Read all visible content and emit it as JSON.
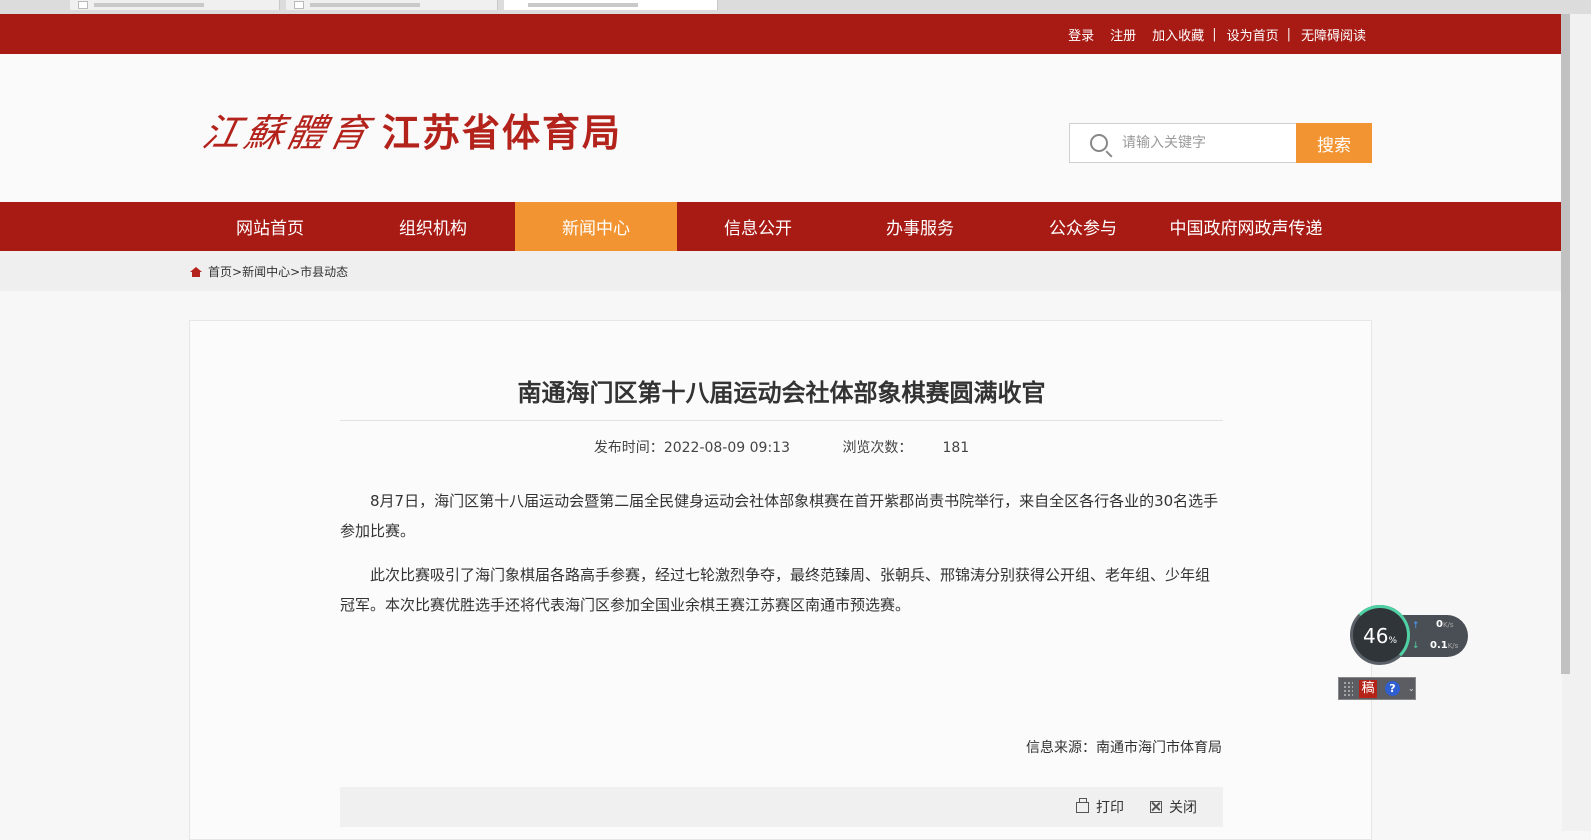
{
  "browser": {
    "tabs": [
      {
        "state": "inactive"
      },
      {
        "state": "inactive"
      },
      {
        "state": "active"
      }
    ]
  },
  "top_links": {
    "login": "登录",
    "register": "注册",
    "bookmark": "加入收藏",
    "set_home": "设为首页",
    "accessible": "无障碍阅读",
    "separator": "|"
  },
  "header": {
    "logo_calligraphy": "江蘇體育",
    "logo_text": "江苏省体育局",
    "search_placeholder": "请输入关键字",
    "search_button": "搜索"
  },
  "nav": {
    "items": [
      {
        "label": "网站首页",
        "active": false
      },
      {
        "label": "组织机构",
        "active": false
      },
      {
        "label": "新闻中心",
        "active": true
      },
      {
        "label": "信息公开",
        "active": false
      },
      {
        "label": "办事服务",
        "active": false
      },
      {
        "label": "公众参与",
        "active": false
      },
      {
        "label": "中国政府网政声传递",
        "active": false
      }
    ]
  },
  "breadcrumb": {
    "home": "首页",
    "sep": ">",
    "level1": "新闻中心",
    "level2": "市县动态"
  },
  "article": {
    "title": "南通海门区第十八届运动会社体部象棋赛圆满收官",
    "publish_label": "发布时间：",
    "publish_time": "2022-08-09 09:13",
    "views_label": "浏览次数：",
    "views": "181",
    "paragraphs": [
      "8月7日，海门区第十八届运动会暨第二届全民健身运动会社体部象棋赛在首开紫郡尚责书院举行，来自全区各行各业的30名选手参加比赛。",
      "此次比赛吸引了海门象棋届各路高手参赛，经过七轮激烈争夺，最终范臻周、张朝兵、邢锦涛分别获得公开组、老年组、少年组冠军。本次比赛优胜选手还将代表海门区参加全国业余棋王赛江苏赛区南通市预选赛。"
    ],
    "source_label": "信息来源：",
    "source": "南通市海门市体育局",
    "print": "打印",
    "close": "关闭"
  },
  "net_widget": {
    "percent": "46",
    "percent_unit": "%",
    "upload": "0",
    "download": "0.1",
    "unit": "K/s",
    "up_arrow": "↑",
    "down_arrow": "↓"
  },
  "ime": {
    "char": "稿",
    "help": "?",
    "menu_arrow": "⌄"
  },
  "colors": {
    "brand_red": "#a81b15",
    "accent_orange": "#f29432"
  }
}
